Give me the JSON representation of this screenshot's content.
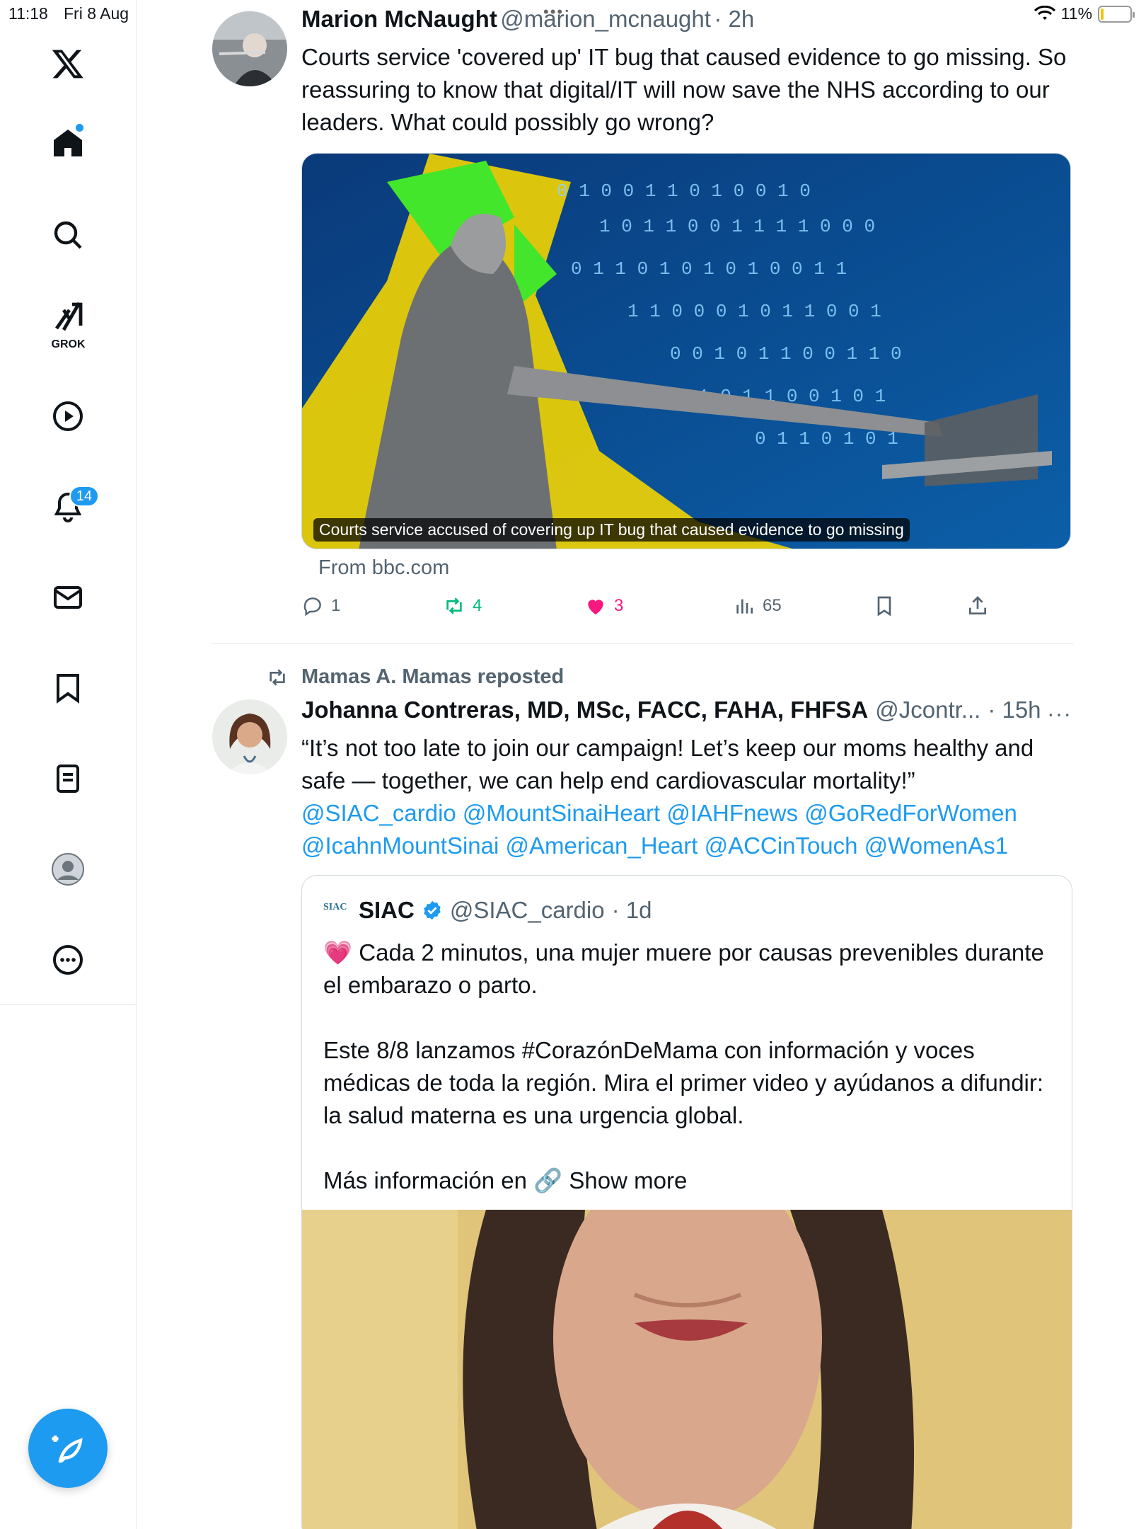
{
  "status_bar": {
    "time": "11:18",
    "date": "Fri 8 Aug",
    "battery": "11%",
    "battery_level": 0.11,
    "multitask_dots": "•••"
  },
  "sidebar": {
    "grok_label": "GROK",
    "notifications_badge": "14",
    "items": [
      "x-logo",
      "home-icon",
      "search-icon",
      "grok-icon",
      "video-icon",
      "notifications-icon",
      "messages-icon",
      "bookmarks-icon",
      "lists-icon",
      "profile-icon",
      "more-icon"
    ]
  },
  "tweet1": {
    "name": "Marion McNaught",
    "handle": "@marion_mcnaught",
    "time": "· 2h",
    "text": "Courts service 'covered up' IT bug that caused evidence to go missing. So reassuring to know that digital/IT will now save the NHS according to our leaders. What could possibly go wrong?",
    "card_caption": "Courts service accused of covering up IT bug that caused evidence to go missing",
    "card_source": "From bbc.com",
    "replies": "1",
    "reposts": "4",
    "likes": "3",
    "views": "65"
  },
  "tweet2": {
    "repost_label": "Mamas A. Mamas reposted",
    "name": "Johanna Contreras, MD, MSc, FACC, FAHA, FHFSA",
    "handle": "@Jcontr...",
    "time": "· 15h",
    "more": "···",
    "text": "“It’s not too late to join our campaign! Let’s keep our moms healthy and safe — together, we can help end cardiovascular mortality!”",
    "mentions_line1": "@SIAC_cardio @MountSinaiHeart @IAHFnews @GoRedForWomen",
    "mentions_line2": "@IcahnMountSinai @American_Heart @ACCinTouch @WomenAs1",
    "quote": {
      "logo_text": "SIAC",
      "name": "SIAC",
      "handle": "@SIAC_cardio",
      "time": "· 1d",
      "text": "💗 Cada 2 minutos, una mujer muere por causas prevenibles durante el embarazo o parto.\n\nEste 8/8 lanzamos #CorazónDeMama con información y voces médicas de toda la región. Mira el primer video y ayúdanos a difundir: la salud materna es una urgencia global.\n\nMás información en 🔗",
      "show_more": "Show more"
    }
  },
  "colors": {
    "accent": "#1d9bf0",
    "repost_green": "#00ba7c",
    "like_pink": "#f91880",
    "muted": "#536471"
  }
}
